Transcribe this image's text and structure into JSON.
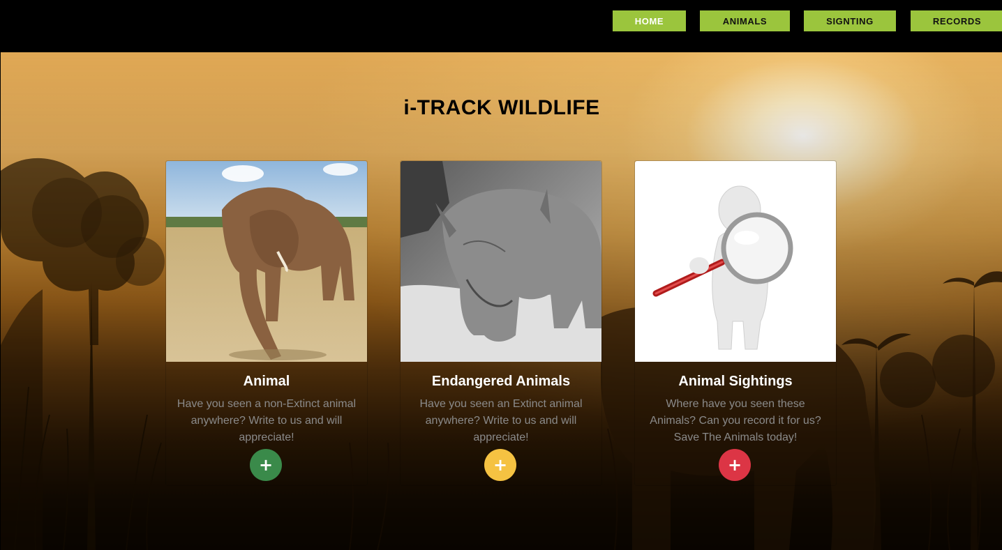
{
  "nav": {
    "items": [
      {
        "label": "HOME",
        "active": true
      },
      {
        "label": "ANIMALS",
        "active": false
      },
      {
        "label": "SIGNTING",
        "active": false
      },
      {
        "label": "RECORDS",
        "active": false
      }
    ],
    "button_color": "#9bc53d"
  },
  "hero": {
    "title": "i-TRACK WILDLIFE"
  },
  "cards": [
    {
      "title": "Animal",
      "text": "Have you seen a non-Extinct animal anywhere? Write to us and will appreciate!",
      "image": "elephant-photo",
      "button_icon": "plus-icon",
      "button_color": "#3a8a4a"
    },
    {
      "title": "Endangered Animals",
      "text": "Have you seen an Extinct animal anywhere? Write to us and will appreciate!",
      "image": "rhino-photo",
      "button_icon": "plus-icon",
      "button_color": "#f5c242"
    },
    {
      "title": "Animal Sightings",
      "text": "Where have you seen these Animals? Can you record it for us? Save The Animals today!",
      "image": "magnifier-figure",
      "button_icon": "plus-icon",
      "button_color": "#dc3545"
    }
  ]
}
